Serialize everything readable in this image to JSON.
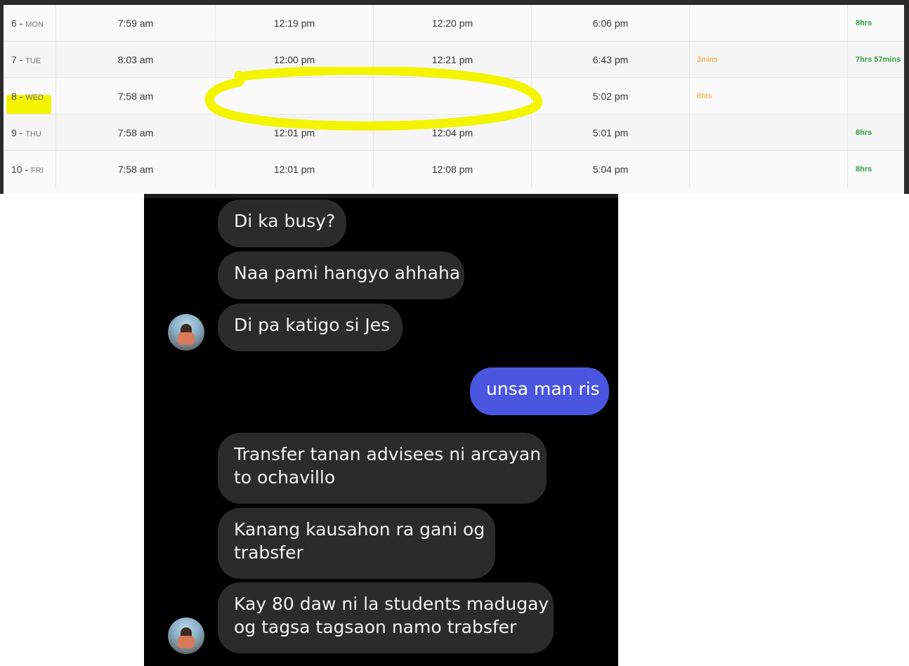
{
  "attendance": {
    "rows": [
      {
        "day": "6",
        "dayname": "MON",
        "in_am": "7:59 am",
        "out_am": "12:19 pm",
        "in_pm": "12:20 pm",
        "out_pm": "6:06 pm",
        "late": "",
        "total": "8hrs"
      },
      {
        "day": "7",
        "dayname": "TUE",
        "in_am": "8:03 am",
        "out_am": "12:00 pm",
        "in_pm": "12:21 pm",
        "out_pm": "6:43 pm",
        "late": "3mins",
        "total": "7hrs 57mins"
      },
      {
        "day": "8",
        "dayname": "WED",
        "in_am": "7:58 am",
        "out_am": "",
        "in_pm": "",
        "out_pm": "5:02 pm",
        "late": "8hrs",
        "total": ""
      },
      {
        "day": "9",
        "dayname": "THU",
        "in_am": "7:58 am",
        "out_am": "12:01 pm",
        "in_pm": "12:04 pm",
        "out_pm": "5:01 pm",
        "late": "",
        "total": "8hrs"
      },
      {
        "day": "10",
        "dayname": "FRI",
        "in_am": "7:58 am",
        "out_am": "12:01 pm",
        "in_pm": "12:08 pm",
        "out_pm": "5:04 pm",
        "late": "",
        "total": "8hrs"
      }
    ],
    "colors": {
      "late": "#f0a020",
      "total": "#2e9e3e",
      "highlight": "#f4f400"
    }
  },
  "chat": {
    "messages": [
      {
        "text": "Di ka busy?",
        "sender": "other"
      },
      {
        "text": "Naa pami hangyo ahhaha",
        "sender": "other"
      },
      {
        "text": "Di pa katigo si Jes",
        "sender": "other"
      },
      {
        "text": "unsa man ris",
        "sender": "me"
      },
      {
        "text": "Transfer tanan advisees ni arcayan",
        "text2": "to ochavillo",
        "sender": "other"
      },
      {
        "text": "Kanang kausahon ra gani og",
        "text2": "trabsfer",
        "sender": "other"
      },
      {
        "text": "Kay 80 daw ni la students madugay",
        "text2": "og tagsa tagsaon namo trabsfer",
        "sender": "other"
      }
    ],
    "colors": {
      "background": "#000000",
      "incoming": "#2b2b2b",
      "outgoing": "#4a55e0"
    }
  }
}
